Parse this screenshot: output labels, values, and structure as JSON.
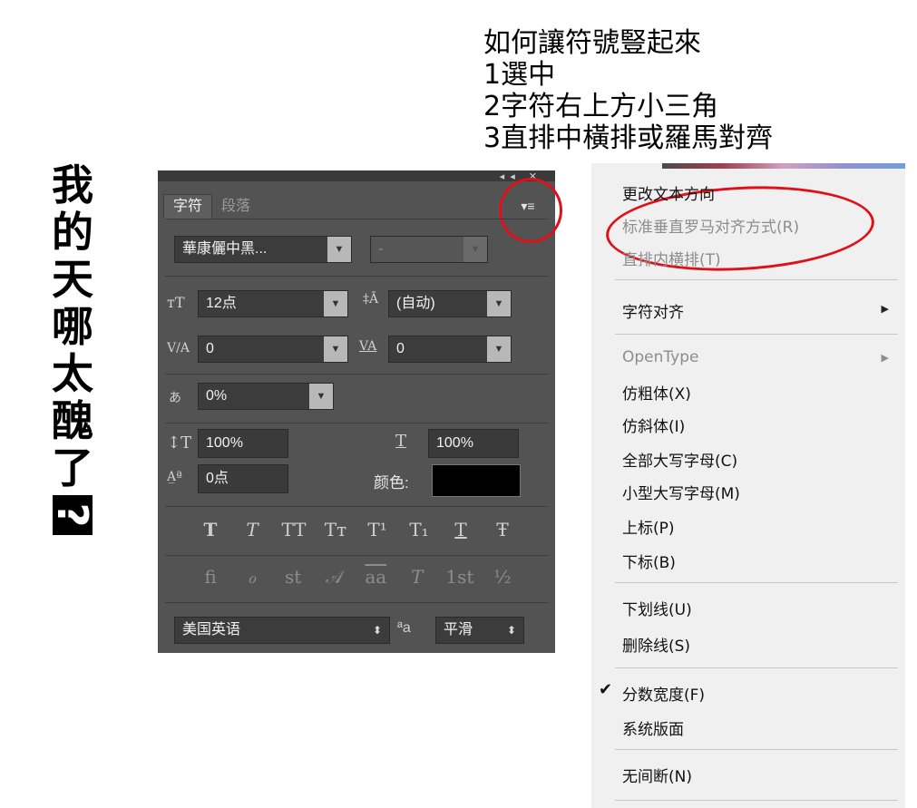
{
  "vertical_title": {
    "chars": [
      "我",
      "的",
      "天",
      "哪",
      "太",
      "醜",
      "了",
      "?"
    ]
  },
  "instructions": {
    "line1": "如何讓符號豎起來",
    "line2": "1選中",
    "line3": "2字符右上方小三角",
    "line4": "3直排中橫排或羅馬對齊"
  },
  "panel": {
    "window_buttons": "◂◂ ✕",
    "tabs": [
      "字符",
      "段落"
    ],
    "menu_icon": "▾≡",
    "font_family": "華康儷中黑...",
    "font_style": "-",
    "font_size": "12点",
    "leading": "(自动)",
    "kerning": "0",
    "tracking": "0",
    "tsume": "0%",
    "vertical_scale": "100%",
    "horizontal_scale": "100%",
    "baseline_shift": "0点",
    "color_label": "颜色:",
    "text_color": "#000000",
    "type_buttons": [
      "T",
      "T",
      "TT",
      "Tт",
      "T¹",
      "T₁",
      "T",
      "Ŧ"
    ],
    "opentype_buttons": [
      "fi",
      "ℴ",
      "st",
      "𝒜",
      "aa",
      "T",
      "1st",
      "½"
    ],
    "language": "美国英语",
    "aa_label": "ªa",
    "anti_alias": "平滑"
  },
  "context_menu": {
    "items": [
      {
        "label": "更改文本方向",
        "enabled": true
      },
      {
        "label": "标准垂直罗马对齐方式(R)",
        "enabled": false
      },
      {
        "label": "直排内横排(T)",
        "enabled": false
      },
      {
        "label": "字符对齐",
        "enabled": true,
        "submenu": true
      },
      {
        "label": "OpenType",
        "enabled": false,
        "submenu": true
      },
      {
        "label": "仿粗体(X)",
        "enabled": true
      },
      {
        "label": "仿斜体(I)",
        "enabled": true
      },
      {
        "label": "全部大写字母(C)",
        "enabled": true
      },
      {
        "label": "小型大写字母(M)",
        "enabled": true
      },
      {
        "label": "上标(P)",
        "enabled": true
      },
      {
        "label": "下标(B)",
        "enabled": true
      },
      {
        "label": "下划线(U)",
        "enabled": true
      },
      {
        "label": "删除线(S)",
        "enabled": true
      },
      {
        "label": "分数宽度(F)",
        "enabled": true,
        "checked": true
      },
      {
        "label": "系统版面",
        "enabled": true
      },
      {
        "label": "无间断(N)",
        "enabled": true
      }
    ],
    "check_mark": "✔",
    "submenu_arrow": "▶"
  },
  "colors": {
    "annotation_red": "#e0101a",
    "panel_bg": "#535353"
  }
}
